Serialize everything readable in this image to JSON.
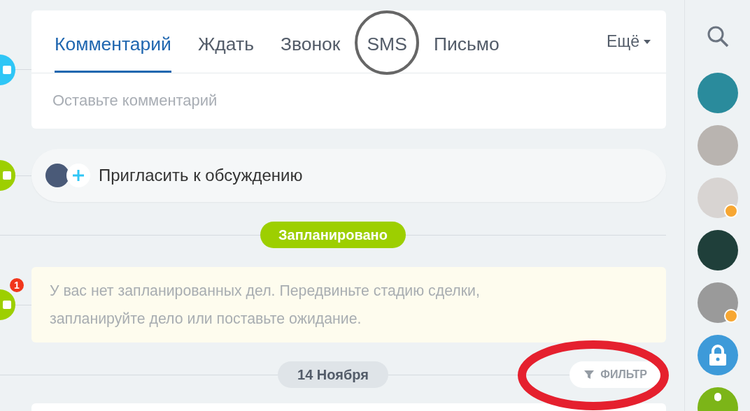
{
  "composer": {
    "marker": {
      "color": "#2fc6f6"
    },
    "tabs": [
      {
        "label": "Комментарий",
        "selected": true
      },
      {
        "label": "Ждать",
        "selected": false
      },
      {
        "label": "Звонок",
        "selected": false
      },
      {
        "label": "SMS",
        "selected": false
      },
      {
        "label": "Письмо",
        "selected": false
      }
    ],
    "more": "Ещё",
    "placeholder": "Оставьте комментарий"
  },
  "invite": {
    "marker": {
      "color": "#9dcf00"
    },
    "label": "Пригласить к обсуждению"
  },
  "planned": {
    "title": "Запланировано",
    "marker": {
      "color": "#9dcf00",
      "badge": "1"
    },
    "message": "У вас нет запланированных дел. Передвиньте стадию сделки, запланируйте дело или поставьте ожидание."
  },
  "history": {
    "date": "14 Ноября",
    "filter": "ФИЛЬТР"
  },
  "sidebar": {
    "items": [
      {
        "kind": "photo",
        "clock": false
      },
      {
        "kind": "photo",
        "clock": false
      },
      {
        "kind": "photo",
        "clock": true
      },
      {
        "kind": "photo",
        "clock": false
      },
      {
        "kind": "photo",
        "clock": true
      },
      {
        "kind": "lock",
        "clock": false
      },
      {
        "kind": "user"
      }
    ]
  }
}
